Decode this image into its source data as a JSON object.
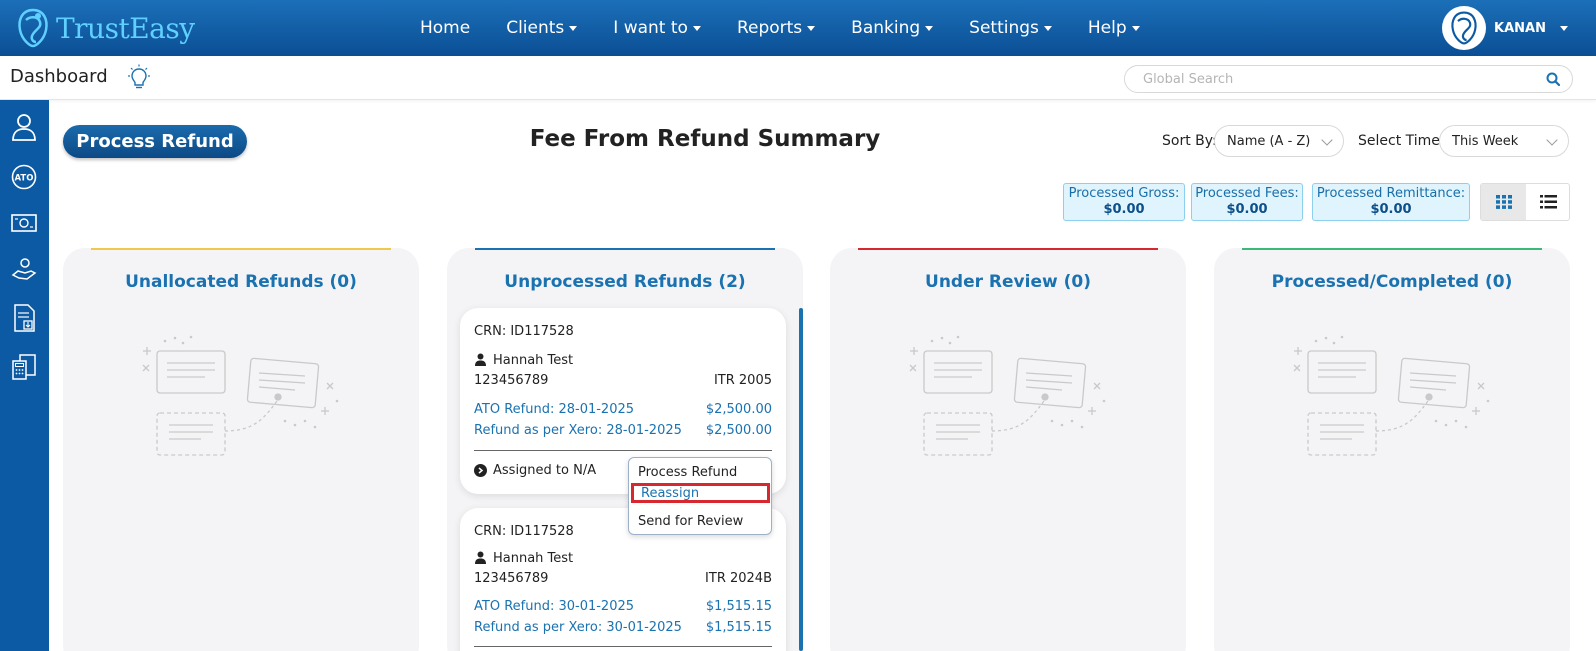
{
  "brand": {
    "name": "TrustEasy"
  },
  "nav": {
    "items": [
      {
        "label": "Home",
        "dropdown": false
      },
      {
        "label": "Clients",
        "dropdown": true
      },
      {
        "label": "I want to",
        "dropdown": true
      },
      {
        "label": "Reports",
        "dropdown": true
      },
      {
        "label": "Banking",
        "dropdown": true
      },
      {
        "label": "Settings",
        "dropdown": true
      },
      {
        "label": "Help",
        "dropdown": true
      }
    ],
    "user": "KANAN"
  },
  "subbar": {
    "title": "Dashboard",
    "search_placeholder": "Global Search"
  },
  "sidebar": {
    "icons": [
      "user-icon",
      "ato-icon",
      "money-icon",
      "hand-coin-icon",
      "document-download-icon",
      "calculator-icon"
    ],
    "ato_label": "ATO"
  },
  "main": {
    "process_button": "Process Refund",
    "title": "Fee From Refund Summary",
    "sort_label": "Sort By:",
    "sort_value": "Name (A - Z)",
    "time_label": "Select Time:",
    "time_value": "This Week",
    "stats": [
      {
        "label": "Processed Gross:",
        "value": "$0.00"
      },
      {
        "label": "Processed Fees:",
        "value": "$0.00"
      },
      {
        "label": "Processed Remittance:",
        "value": "$0.00"
      }
    ]
  },
  "columns": [
    {
      "title": "Unallocated Refunds (0)",
      "accent": "#f0c94a"
    },
    {
      "title": "Unprocessed Refunds (2)",
      "accent": "#1a72b0"
    },
    {
      "title": "Under Review (0)",
      "accent": "#d7282f"
    },
    {
      "title": "Processed/Completed (0)",
      "accent": "#3cb878"
    }
  ],
  "cards": [
    {
      "crn": "CRN: ID117528",
      "name": "Hannah Test",
      "tfn": "123456789",
      "itr": "ITR 2005",
      "ato_refund": "ATO Refund: 28-01-2025",
      "ato_amount": "$2,500.00",
      "xero_refund": "Refund as per Xero: 28-01-2025",
      "xero_amount": "$2,500.00",
      "assigned": "Assigned to N/A"
    },
    {
      "crn": "CRN: ID117528",
      "name": "Hannah Test",
      "tfn": "123456789",
      "itr": "ITR 2024B",
      "ato_refund": "ATO Refund: 30-01-2025",
      "ato_amount": "$1,515.15",
      "xero_refund": "Refund as per Xero: 30-01-2025",
      "xero_amount": "$1,515.15"
    }
  ],
  "context_menu": {
    "items": [
      "Process Refund",
      "Reassign",
      "Send for Review"
    ],
    "active": "Reassign"
  },
  "colors": {
    "primary": "#0b5aa3",
    "accent_blue": "#1a72b0",
    "highlight_red": "#d7282f"
  }
}
